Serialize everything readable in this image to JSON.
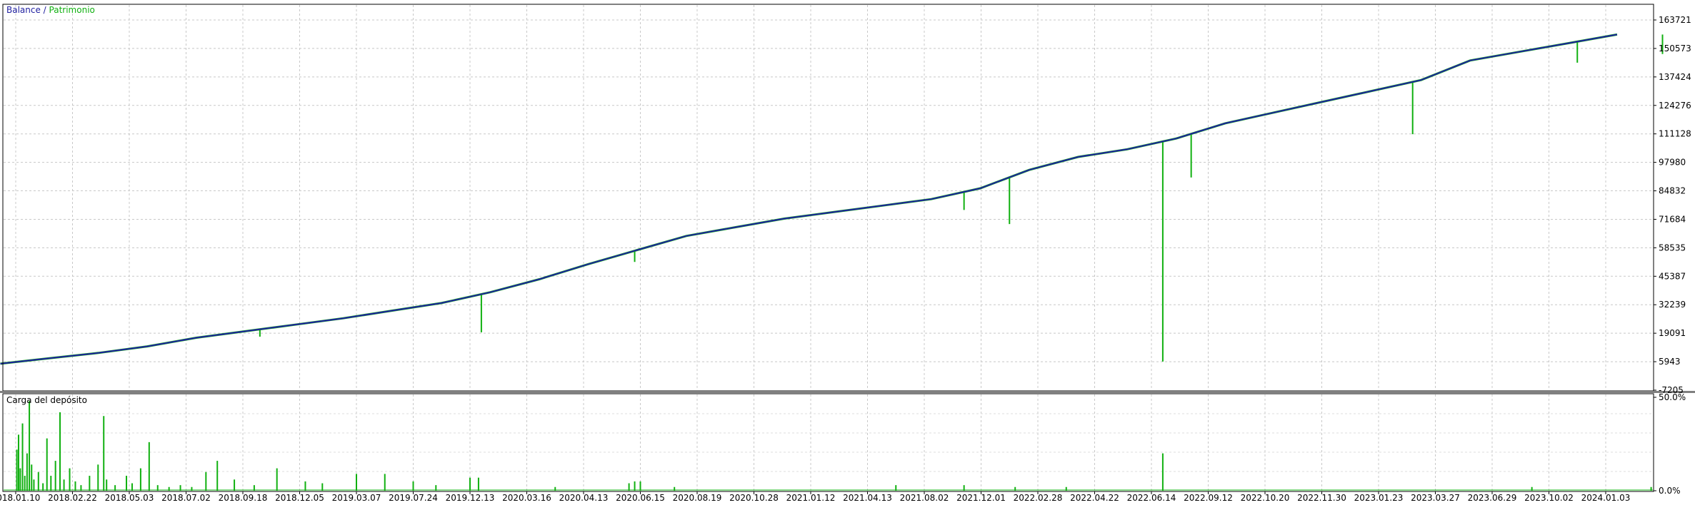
{
  "chart_data": [
    {
      "type": "line",
      "legend": [
        {
          "name": "Balance",
          "color": "#1f1fa0"
        },
        {
          "name": "Patrimonio",
          "color": "#10b010"
        }
      ],
      "legend_separator": " / ",
      "y_ticks": [
        "163721",
        "150573",
        "137424",
        "124276",
        "111128",
        "97980",
        "84832",
        "71684",
        "58535",
        "45387",
        "32239",
        "19091",
        "5943",
        "-7205"
      ],
      "ylim": [
        -7205,
        170000
      ],
      "grid": true,
      "x_ticks": [
        "2018.01.10",
        "2018.02.22",
        "2018.05.03",
        "2018.07.02",
        "2018.09.18",
        "2018.12.05",
        "2019.03.07",
        "2019.07.24",
        "2019.12.13",
        "2020.03.16",
        "2020.04.13",
        "2020.06.15",
        "2020.08.19",
        "2020.10.28",
        "2021.01.12",
        "2021.04.13",
        "2021.08.02",
        "2021.12.01",
        "2022.02.28",
        "2022.04.22",
        "2022.06.14",
        "2022.09.12",
        "2022.10.20",
        "2022.11.30",
        "2023.01.23",
        "2023.03.27",
        "2023.06.29",
        "2023.10.02",
        "2024.01.03"
      ],
      "series": [
        {
          "name": "Balance",
          "color": "#1f1fa0",
          "values": [
            5000,
            7500,
            10000,
            13000,
            17000,
            20000,
            23000,
            26000,
            29500,
            33000,
            38000,
            44000,
            51000,
            57500,
            64000,
            68000,
            72000,
            75000,
            78000,
            81000,
            86000,
            94500,
            100500,
            104000,
            109000,
            116000,
            121000,
            126000,
            131000,
            136000,
            145000,
            149000,
            153000,
            157000
          ]
        },
        {
          "name": "Patrimonio",
          "color": "#10b010",
          "drawdowns": [
            {
              "x_index": 4.3,
              "low": 17500
            },
            {
              "x_index": 8.2,
              "low": 19500
            },
            {
              "x_index": 10.9,
              "low": 52000
            },
            {
              "x_index": 16.7,
              "low": 76000
            },
            {
              "x_index": 17.5,
              "low": 69500
            },
            {
              "x_index": 20.2,
              "low": 6000
            },
            {
              "x_index": 20.7,
              "low": 91000
            },
            {
              "x_index": 24.6,
              "low": 111000
            },
            {
              "x_index": 27.5,
              "low": 144000
            },
            {
              "x_index": 29.0,
              "low": 148000
            }
          ]
        }
      ]
    },
    {
      "type": "bar",
      "title": "Carga del depósito",
      "y_ticks": [
        "50.0%",
        "0.0%"
      ],
      "ylim": [
        0,
        50
      ],
      "color": "#10b010",
      "x_ticks": [
        "2018.01.10",
        "2018.02.22",
        "2018.05.03",
        "2018.07.02",
        "2018.09.18",
        "2018.12.05",
        "2019.03.07",
        "2019.07.24",
        "2019.12.13",
        "2020.03.16",
        "2020.04.13",
        "2020.06.15",
        "2020.08.19",
        "2020.10.28",
        "2021.01.12",
        "2021.04.13",
        "2021.08.02",
        "2021.12.01",
        "2022.02.28",
        "2022.04.22",
        "2022.06.14",
        "2022.09.12",
        "2022.10.20",
        "2022.11.30",
        "2023.01.23",
        "2023.03.27",
        "2023.06.29",
        "2023.10.02",
        "2024.01.03"
      ],
      "bars": [
        {
          "x_index": 0.02,
          "value": 22
        },
        {
          "x_index": 0.05,
          "value": 30
        },
        {
          "x_index": 0.08,
          "value": 12
        },
        {
          "x_index": 0.12,
          "value": 36
        },
        {
          "x_index": 0.16,
          "value": 8
        },
        {
          "x_index": 0.2,
          "value": 20
        },
        {
          "x_index": 0.24,
          "value": 48
        },
        {
          "x_index": 0.28,
          "value": 14
        },
        {
          "x_index": 0.32,
          "value": 6
        },
        {
          "x_index": 0.4,
          "value": 10
        },
        {
          "x_index": 0.48,
          "value": 4
        },
        {
          "x_index": 0.55,
          "value": 28
        },
        {
          "x_index": 0.62,
          "value": 8
        },
        {
          "x_index": 0.7,
          "value": 16
        },
        {
          "x_index": 0.78,
          "value": 42
        },
        {
          "x_index": 0.85,
          "value": 6
        },
        {
          "x_index": 0.95,
          "value": 12
        },
        {
          "x_index": 1.05,
          "value": 5
        },
        {
          "x_index": 1.15,
          "value": 3
        },
        {
          "x_index": 1.3,
          "value": 8
        },
        {
          "x_index": 1.45,
          "value": 14
        },
        {
          "x_index": 1.55,
          "value": 40
        },
        {
          "x_index": 1.6,
          "value": 6
        },
        {
          "x_index": 1.75,
          "value": 3
        },
        {
          "x_index": 1.95,
          "value": 8
        },
        {
          "x_index": 2.05,
          "value": 4
        },
        {
          "x_index": 2.2,
          "value": 12
        },
        {
          "x_index": 2.35,
          "value": 26
        },
        {
          "x_index": 2.5,
          "value": 3
        },
        {
          "x_index": 2.7,
          "value": 2
        },
        {
          "x_index": 2.9,
          "value": 3
        },
        {
          "x_index": 3.1,
          "value": 2
        },
        {
          "x_index": 3.35,
          "value": 10
        },
        {
          "x_index": 3.55,
          "value": 16
        },
        {
          "x_index": 3.85,
          "value": 6
        },
        {
          "x_index": 4.2,
          "value": 3
        },
        {
          "x_index": 4.6,
          "value": 12
        },
        {
          "x_index": 5.1,
          "value": 5
        },
        {
          "x_index": 5.4,
          "value": 4
        },
        {
          "x_index": 6.0,
          "value": 9
        },
        {
          "x_index": 6.5,
          "value": 9
        },
        {
          "x_index": 7.0,
          "value": 5
        },
        {
          "x_index": 7.4,
          "value": 3
        },
        {
          "x_index": 8.0,
          "value": 7
        },
        {
          "x_index": 8.15,
          "value": 7
        },
        {
          "x_index": 9.5,
          "value": 2
        },
        {
          "x_index": 10.8,
          "value": 4
        },
        {
          "x_index": 10.9,
          "value": 5
        },
        {
          "x_index": 11.0,
          "value": 5
        },
        {
          "x_index": 11.6,
          "value": 2
        },
        {
          "x_index": 15.5,
          "value": 3
        },
        {
          "x_index": 16.7,
          "value": 3
        },
        {
          "x_index": 17.6,
          "value": 2
        },
        {
          "x_index": 18.5,
          "value": 2
        },
        {
          "x_index": 20.2,
          "value": 20
        },
        {
          "x_index": 26.7,
          "value": 2
        },
        {
          "x_index": 28.8,
          "value": 2
        }
      ]
    }
  ]
}
